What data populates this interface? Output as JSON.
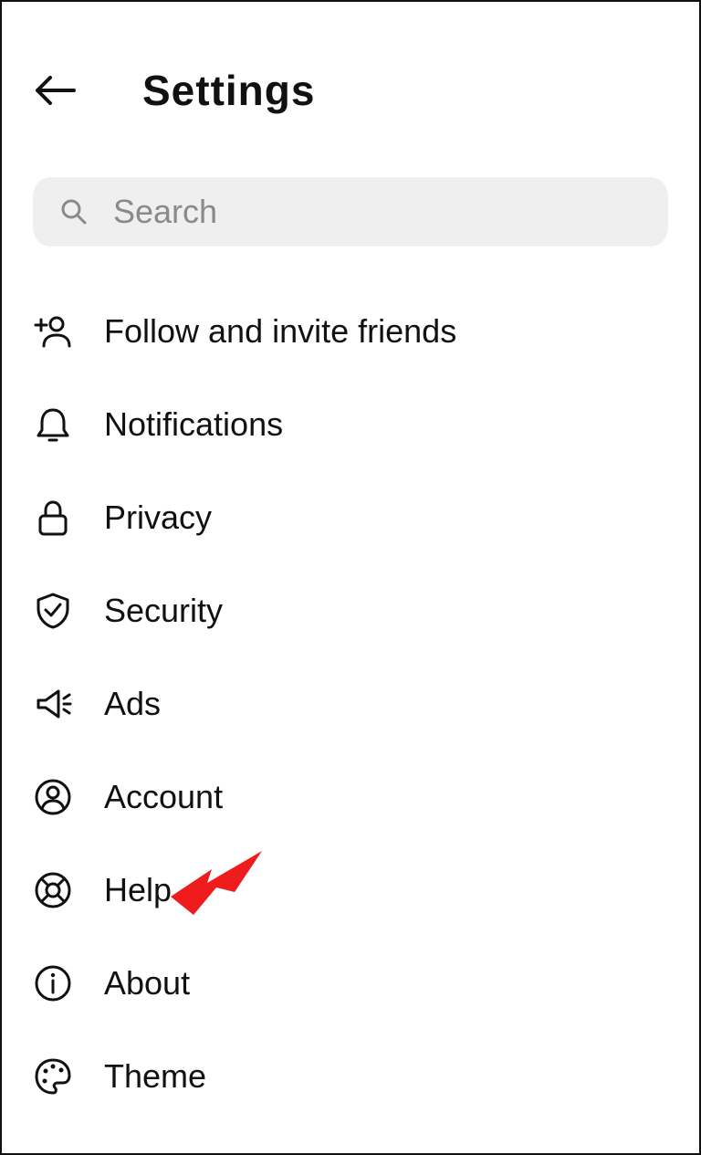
{
  "header": {
    "title": "Settings"
  },
  "search": {
    "placeholder": "Search",
    "value": ""
  },
  "menu": {
    "items": [
      {
        "label": "Follow and invite friends",
        "icon": "user-plus"
      },
      {
        "label": "Notifications",
        "icon": "bell"
      },
      {
        "label": "Privacy",
        "icon": "lock"
      },
      {
        "label": "Security",
        "icon": "shield-check"
      },
      {
        "label": "Ads",
        "icon": "megaphone"
      },
      {
        "label": "Account",
        "icon": "user-circle"
      },
      {
        "label": "Help",
        "icon": "lifebuoy"
      },
      {
        "label": "About",
        "icon": "info"
      },
      {
        "label": "Theme",
        "icon": "palette"
      }
    ]
  },
  "annotation": {
    "arrow_points_to": "Help"
  }
}
